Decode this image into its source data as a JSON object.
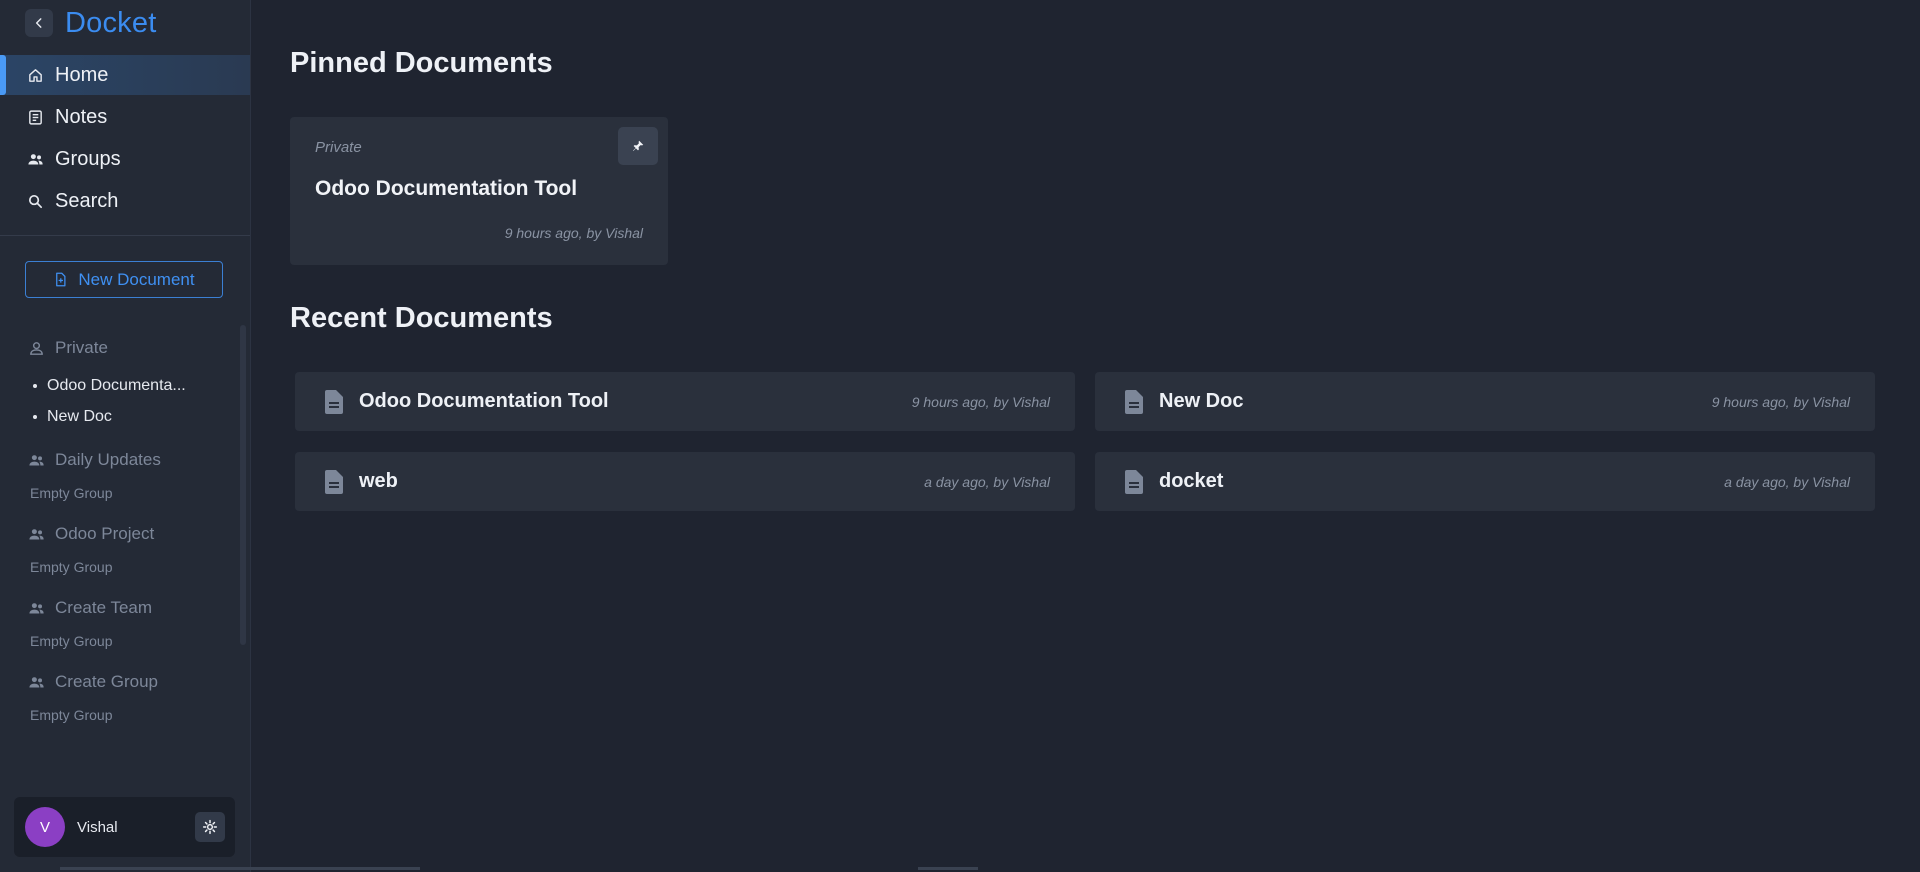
{
  "app": {
    "name": "Docket",
    "accent": "#3b8cf0"
  },
  "nav": [
    {
      "label": "Home",
      "icon": "home-icon",
      "active": true
    },
    {
      "label": "Notes",
      "icon": "notes-icon",
      "active": false
    },
    {
      "label": "Groups",
      "icon": "groups-icon",
      "active": false
    },
    {
      "label": "Search",
      "icon": "search-icon",
      "active": false
    }
  ],
  "new_document_label": "New Document",
  "tree": {
    "private": {
      "label": "Private",
      "docs": [
        "Odoo Documenta...",
        "New Doc"
      ]
    },
    "groups": [
      {
        "label": "Daily Updates",
        "status": "Empty Group"
      },
      {
        "label": "Odoo Project",
        "status": "Empty Group"
      },
      {
        "label": "Create Team",
        "status": "Empty Group"
      },
      {
        "label": "Create Group",
        "status": "Empty Group"
      }
    ]
  },
  "user": {
    "initial": "V",
    "name": "Vishal",
    "avatar_color": "#8b3fc4"
  },
  "pinned": {
    "heading": "Pinned Documents",
    "cards": [
      {
        "scope": "Private",
        "title": "Odoo Documentation Tool",
        "meta": "9 hours ago, by Vishal"
      }
    ]
  },
  "recent": {
    "heading": "Recent Documents",
    "docs": [
      {
        "title": "Odoo Documentation Tool",
        "meta": "9 hours ago, by Vishal"
      },
      {
        "title": "New Doc",
        "meta": "9 hours ago, by Vishal"
      },
      {
        "title": "web",
        "meta": "a day ago, by Vishal"
      },
      {
        "title": "docket",
        "meta": "a day ago, by Vishal"
      }
    ]
  }
}
